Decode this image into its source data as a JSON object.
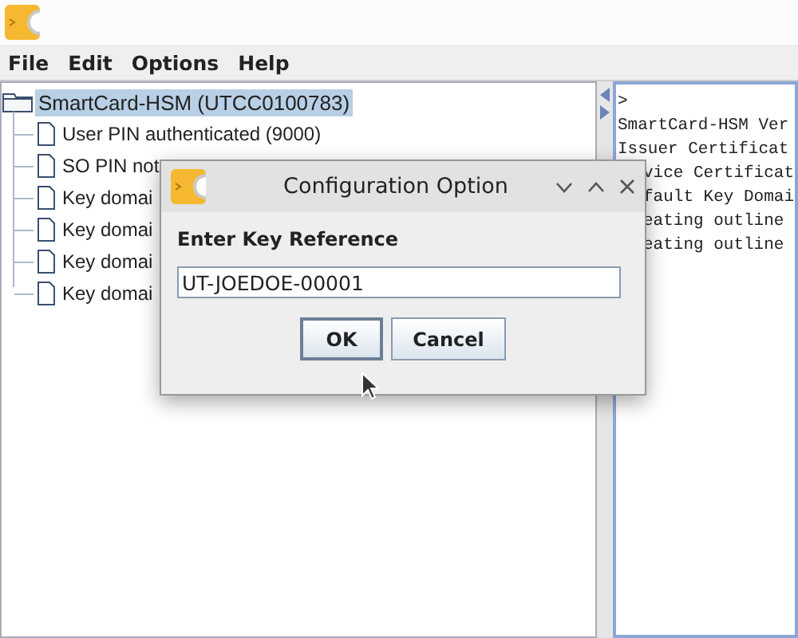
{
  "menu": [
    "File",
    "Edit",
    "Options",
    "Help"
  ],
  "tree": {
    "label": "SmartCard-HSM (UTCC0100783)",
    "selected": true,
    "children": [
      {
        "label": "User PIN authenticated (9000)"
      },
      {
        "label": "SO PIN not"
      },
      {
        "label": "Key domai"
      },
      {
        "label": "Key domai"
      },
      {
        "label": "Key domai"
      },
      {
        "label": "Key domai"
      }
    ]
  },
  "console": [
    {
      "text": ">",
      "covered": false
    },
    {
      "text": "SmartCard-HSM Ver",
      "covered": false
    },
    {
      "text": "Issuer Certificat",
      "covered": false
    },
    {
      "text": "vice Certificat",
      "covered": true
    },
    {
      "text": "fault Key Domai",
      "covered": true
    },
    {
      "text": "eating outline",
      "covered": true
    },
    {
      "text": "eating outline",
      "covered": true
    }
  ],
  "dialog": {
    "title": "Configuration Option",
    "prompt": "Enter Key Reference",
    "value": "UT-JOEDOE-00001",
    "buttons": [
      {
        "label": "OK",
        "focused": true
      },
      {
        "label": "Cancel",
        "focused": false
      }
    ]
  }
}
